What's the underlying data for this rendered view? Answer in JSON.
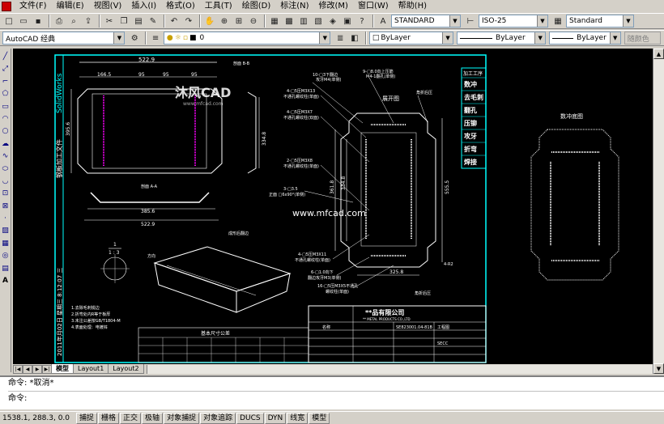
{
  "menu": [
    "文件(F)",
    "编辑(E)",
    "视图(V)",
    "插入(I)",
    "格式(O)",
    "工具(T)",
    "绘图(D)",
    "标注(N)",
    "修改(M)",
    "窗口(W)",
    "帮助(H)"
  ],
  "toolbar1": {
    "text_style": "STANDARD",
    "dim_style": "ISO-25",
    "table_style": "Standard"
  },
  "toolbar2": {
    "workspace": "AutoCAD 经典",
    "layer": "0",
    "color": "ByLayer",
    "linetype": "ByLayer",
    "lineweight": "ByLayer",
    "plotstyle": "随颜色"
  },
  "drawing": {
    "dims": {
      "top_width": "522.9",
      "d1": "166.5",
      "d2": "95",
      "d3": "95",
      "d4": "95",
      "left_h": "395.6",
      "right_h": "334.8",
      "bottom1": "385.6",
      "bottom2": "522.9",
      "section": "剖面 B-B",
      "section2": "剖面 A-A",
      "v1": "361.8",
      "v2": "334.8",
      "v3": "555.5",
      "v4": "325.8"
    },
    "notes": {
      "n1": "10-□3下翻边\n攻牙M4(单侧)",
      "n2": "9-□8.0向上压筋\nM4-1翻孔(单侧)",
      "n3": "4-□5压M3X13\n不通孔螺纹柱(单面)",
      "n4": "4-□5压M3X7\n不通孔螺纹柱(双面)",
      "n5": "2-□5压M3X8\n不通孔螺纹柱(单面)",
      "n6": "3-□3.5",
      "n7": "正面 □6x90°(单侧)",
      "n8": "4-□5压M3X11\n不通孔螺纹柱(单面)",
      "n9": "6-□1.0向下\n翻边攻牙M3(单侧)",
      "n10": "16-□5压M3X5不通孔\n螺纹柱(单面)",
      "unfold": "展开图",
      "unfold2": "展开图",
      "press_view": "数冲底图",
      "cut_corner": "角折后压",
      "dir_label": "4-R2",
      "scale": "1\n1 : 3",
      "top_logo": "方向",
      "side_label": "SolidWorks",
      "vert1": "钢板加工文件",
      "vert2": "2011年月02日 星期三 8:12:07 三",
      "note_lines": "1.去除毛刺锐边\n2.折弯处内R等于板厚\n3.未注公差按GB/T1804-M\n4.表面处理：电镀锌\n5.材料：SECC",
      "company": "**品有限公司",
      "company_en": "** METAL PRODUCTS CO.,LTD",
      "table_title": "基本尺寸公差",
      "tb_hdr": "名称",
      "tb_part": "SE823001.04-81B",
      "tb_drawing": "工程图",
      "tb_material": "SECC",
      "ps_header": "加工工序",
      "ps": [
        "数冲",
        "去毛刺",
        "翻孔",
        "压铆",
        "攻牙",
        "折弯",
        "焊接"
      ]
    },
    "watermark": "沐风CAD",
    "watermark_url": "www.mfcad.com",
    "watermark2": "www.mfcad.com"
  },
  "tabs": [
    "模型",
    "Layout1",
    "Layout2"
  ],
  "command": {
    "line1": "命令:  *取消*",
    "line2": "命令:"
  },
  "status": {
    "coords": "1538.1, 288.3, 0.0",
    "buttons": [
      "捕捉",
      "栅格",
      "正交",
      "极轴",
      "对象捕捉",
      "对象追踪",
      "DUCS",
      "DYN",
      "线宽",
      "模型"
    ]
  }
}
